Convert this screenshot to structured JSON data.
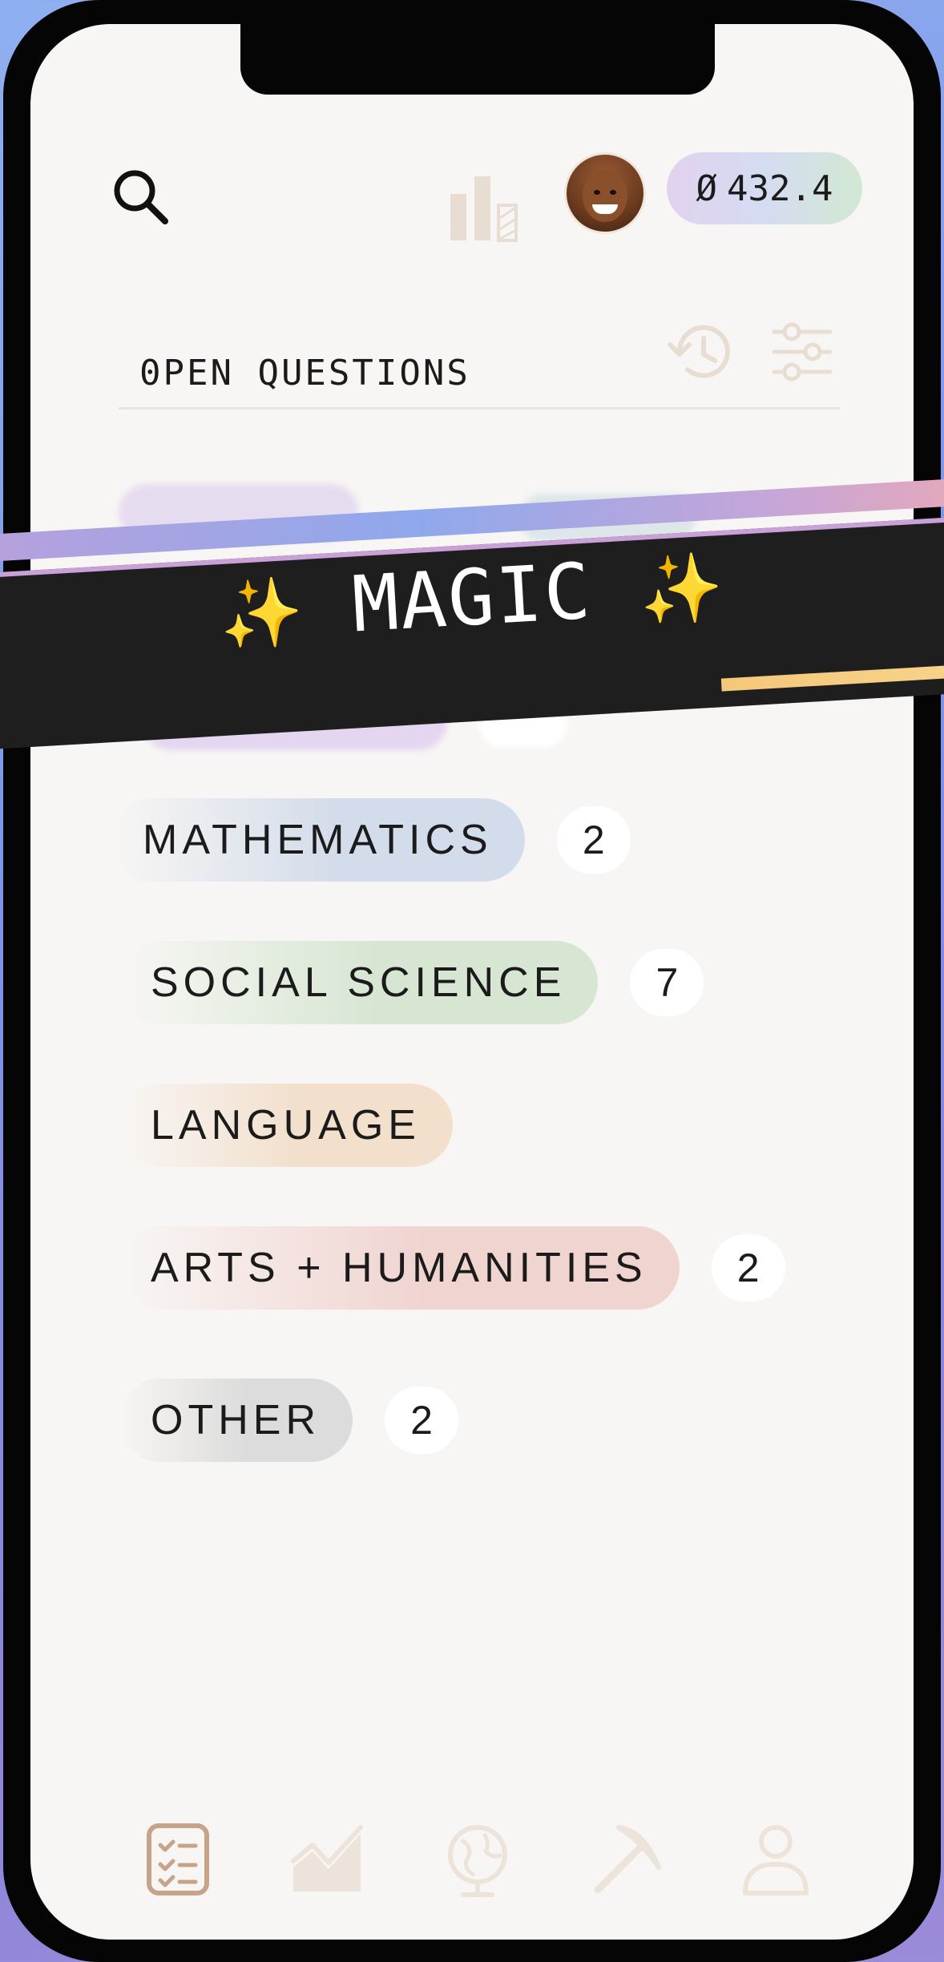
{
  "header": {
    "balance_symbol": "Ø",
    "balance_value": "432.4"
  },
  "icons": {
    "search": "search-icon",
    "stats": "bar-chart-icon",
    "history": "history-icon",
    "filter": "sliders-icon"
  },
  "section": {
    "title": "0PEN QUESTIONS"
  },
  "banner": {
    "text": "MAGIC",
    "sparkle": "✨"
  },
  "categories": [
    {
      "label": "MATHEMATICS",
      "count": "2",
      "color": "#d3dcea"
    },
    {
      "label": "SOCIAL SCIENCE",
      "count": "7",
      "color": "#d6e6d2"
    },
    {
      "label": "LANGUAGE",
      "count": "",
      "color": "#f2dfcc"
    },
    {
      "label": "ARTS + HUMANITIES",
      "count": "2",
      "color": "#f0d4d0"
    },
    {
      "label": "OTHER",
      "count": "2",
      "color": "#dcdcdc"
    }
  ],
  "nav": [
    "tasks-icon",
    "trend-chart-icon",
    "globe-icon",
    "pickaxe-icon",
    "profile-icon"
  ],
  "colors": {
    "accent_brown": "#c6a48a",
    "muted_icon": "#e8ddd2",
    "background": "#f8f6f4"
  }
}
